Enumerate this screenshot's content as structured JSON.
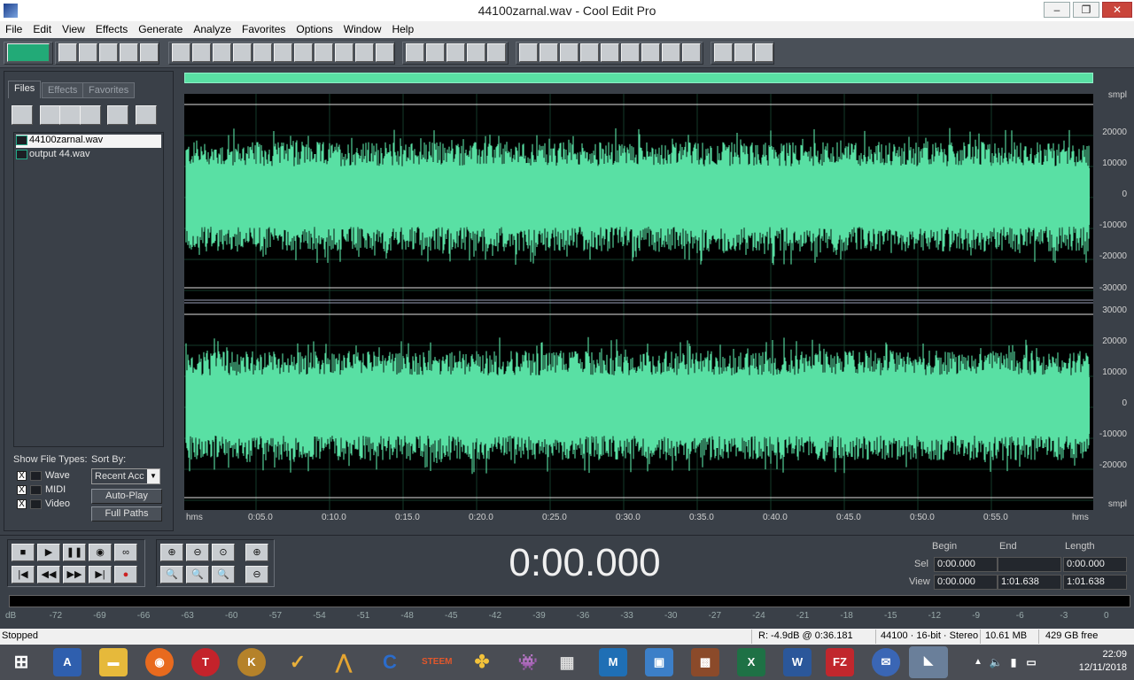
{
  "window": {
    "title": "44100zarnal.wav - Cool Edit Pro",
    "minimize": "–",
    "maximize": "❐",
    "close": "✕"
  },
  "menu": [
    "File",
    "Edit",
    "View",
    "Effects",
    "Generate",
    "Analyze",
    "Favorites",
    "Options",
    "Window",
    "Help"
  ],
  "left_panel": {
    "tabs": [
      "Files",
      "Effects",
      "Favorites"
    ],
    "active_tab": "Files",
    "files": [
      "44100zarnal.wav",
      "output 44.wav"
    ],
    "selected_file": "44100zarnal.wav",
    "show_file_types_label": "Show File Types:",
    "sort_by_label": "Sort By:",
    "types": [
      {
        "label": "Wave",
        "checked": "X"
      },
      {
        "label": "MIDI",
        "checked": "X"
      },
      {
        "label": "Video",
        "checked": "X"
      }
    ],
    "sort_value": "Recent Acc",
    "auto_play": "Auto-Play",
    "full_paths": "Full Paths"
  },
  "wave": {
    "top_unit": "smpl",
    "bottom_unit": "smpl",
    "channel1_ticks": [
      "20000",
      "10000",
      "0",
      "-10000",
      "-20000",
      "-30000"
    ],
    "channel2_ticks": [
      "30000",
      "20000",
      "10000",
      "0",
      "-10000",
      "-20000"
    ],
    "time_start_label": "hms",
    "time_end_label": "hms",
    "time_ticks": [
      "0:05.0",
      "0:10.0",
      "0:15.0",
      "0:20.0",
      "0:25.0",
      "0:30.0",
      "0:35.0",
      "0:40.0",
      "0:45.0",
      "0:50.0",
      "0:55.0"
    ],
    "wave_color": "#59e0a4"
  },
  "transport": {
    "time_display": "0:00.000",
    "headers": {
      "begin": "Begin",
      "end": "End",
      "length": "Length"
    },
    "sel": {
      "label": "Sel",
      "begin": "0:00.000",
      "end": "",
      "length": "0:00.000"
    },
    "view": {
      "label": "View",
      "begin": "0:00.000",
      "end": "1:01.638",
      "length": "1:01.638"
    }
  },
  "meter": {
    "ticks": [
      "dB",
      "-72",
      "-69",
      "-66",
      "-63",
      "-60",
      "-57",
      "-54",
      "-51",
      "-48",
      "-45",
      "-42",
      "-39",
      "-36",
      "-33",
      "-30",
      "-27",
      "-24",
      "-21",
      "-18",
      "-15",
      "-12",
      "-9",
      "-6",
      "-3",
      "0"
    ]
  },
  "status": {
    "state": "Stopped",
    "readout": "R: -4.9dB @  0:36.181",
    "format": "44100 · 16-bit · Stereo",
    "size": "10.61 MB",
    "free": "429 GB free"
  },
  "taskbar": {
    "time": "22:09",
    "date": "12/11/2018"
  }
}
